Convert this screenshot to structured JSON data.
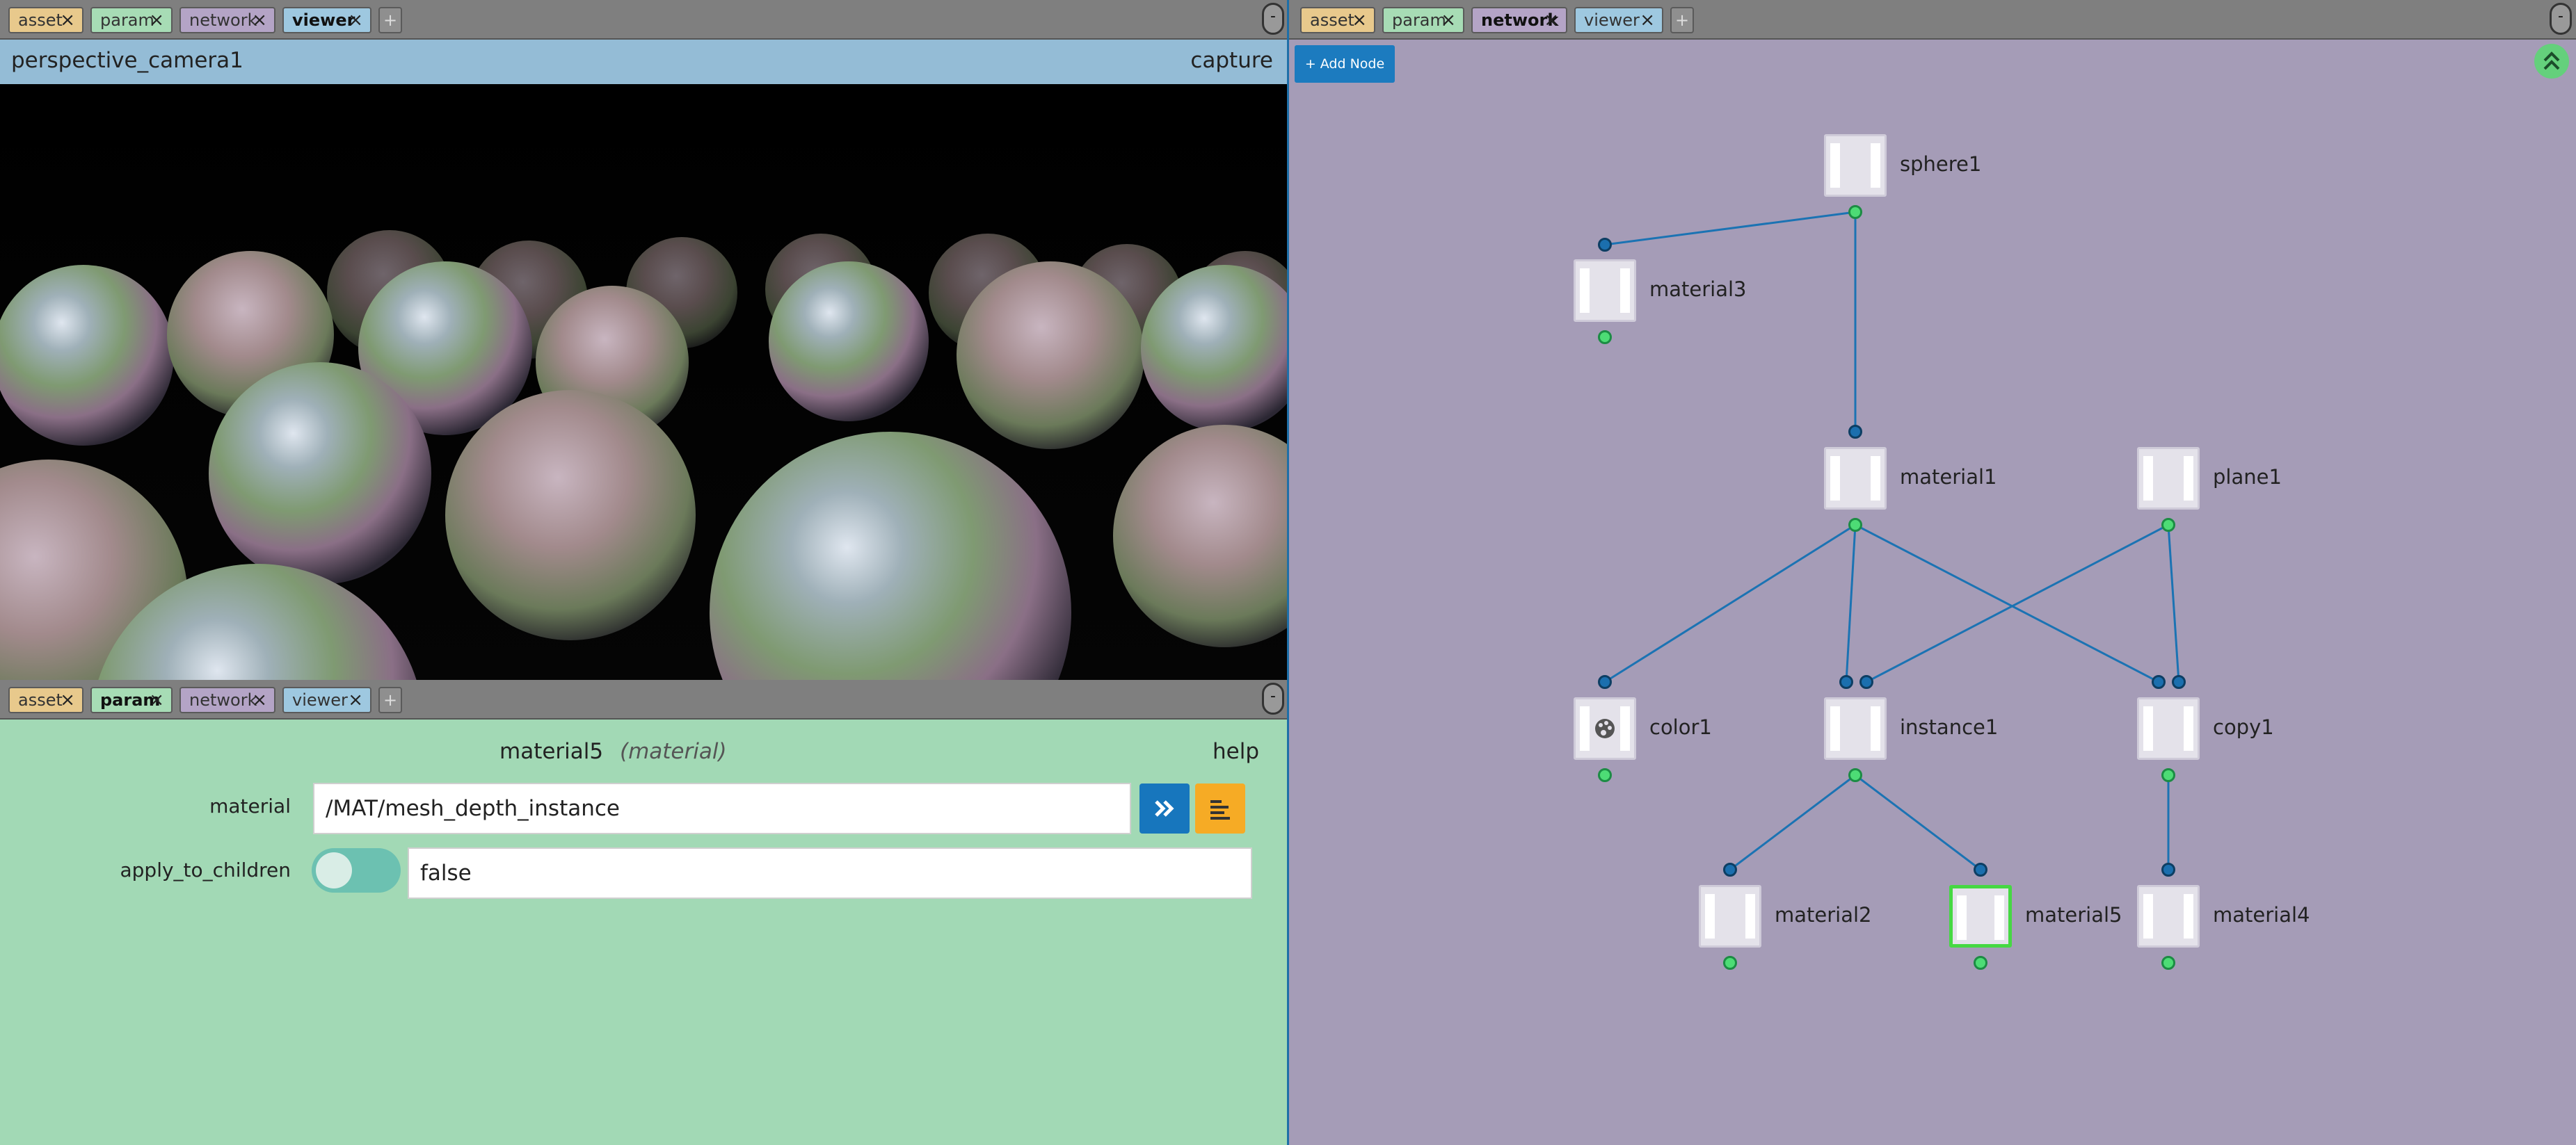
{
  "tabs": {
    "asset": "asset",
    "param": "param",
    "network": "network",
    "viewer": "viewer",
    "close": "×",
    "add": "+",
    "pane_menu": "-"
  },
  "viewer": {
    "camera": "perspective_camera1",
    "capture": "capture"
  },
  "param": {
    "node_name": "material5",
    "node_type": "(material)",
    "help": "help",
    "fields": {
      "material": {
        "label": "material",
        "value": "/MAT/mesh_depth_instance"
      },
      "apply_to_children": {
        "label": "apply_to_children",
        "value": "false",
        "toggle": false
      }
    }
  },
  "network": {
    "add_node": "+ Add Node",
    "nodes": {
      "sphere1": "sphere1",
      "material3": "material3",
      "material1": "material1",
      "plane1": "plane1",
      "color1": "color1",
      "instance1": "instance1",
      "copy1": "copy1",
      "material2": "material2",
      "material5": "material5",
      "material4": "material4"
    },
    "selected": "material5",
    "colors": {
      "wire": "#1b73b3",
      "selected": "#46d843",
      "input_port": "#1b6fae",
      "output_port": "#4ddc75"
    }
  }
}
